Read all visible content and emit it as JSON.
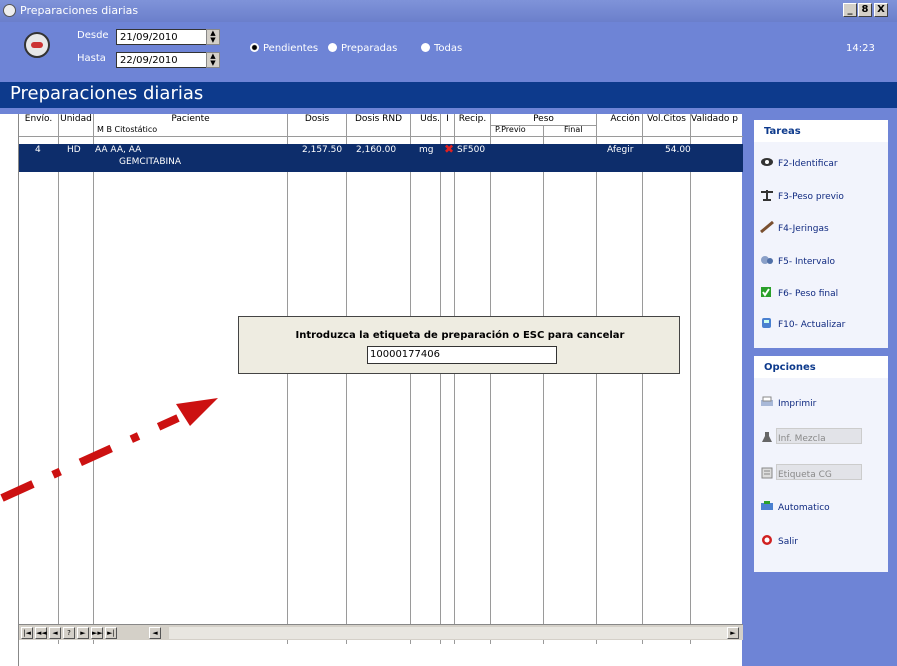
{
  "window": {
    "title": "Preparaciones diarias",
    "buttons": [
      "_",
      "8",
      "X"
    ]
  },
  "header": {
    "desde_label": "Desde",
    "hasta_label": "Hasta",
    "desde_value": "21/09/2010",
    "hasta_value": "22/09/2010",
    "radios": [
      {
        "label": "Pendientes",
        "selected": true
      },
      {
        "label": "Preparadas",
        "selected": false
      },
      {
        "label": "Todas",
        "selected": false
      }
    ],
    "clock": "14:23"
  },
  "section_title": "Preparaciones diarias",
  "table": {
    "headers": [
      "Envío.",
      "Unidad",
      "Paciente",
      "Dosis",
      "Dosis RND",
      "Uds.",
      "I",
      "Recip.",
      "Peso",
      "Acción",
      "Vol.Citos",
      "Validado p"
    ],
    "subheaders": {
      "paciente": "M  B  Citostático",
      "peso_previo": "P.Previo",
      "peso_final": "Final"
    },
    "rows": [
      {
        "envio": "4",
        "unidad": "HD",
        "paciente": "AA AA, AA",
        "citostatico": "GEMCITABINA",
        "dosis": "2,157.50",
        "dosis_rnd": "2,160.00",
        "uds": "mg",
        "recip": "SF500",
        "accion": "Afegir",
        "vol_citos": "54.00"
      }
    ]
  },
  "nav": {
    "buttons": [
      "|◄",
      "◄◄",
      "◄",
      "?",
      "►",
      "►►",
      "►|",
      "◄",
      "►"
    ]
  },
  "dialog": {
    "prompt": "Introduzca la etiqueta de preparación o ESC para cancelar",
    "value": "10000177406"
  },
  "tareas": {
    "title": "Tareas",
    "items": [
      "F2-Identificar",
      "F3-Peso previo",
      "F4-Jeringas",
      "F5- Intervalo",
      "F6- Peso final",
      "F10- Actualizar"
    ]
  },
  "opciones": {
    "title": "Opciones",
    "items": [
      "Imprimir",
      "Inf. Mezcla",
      "Etiqueta CG",
      "Automatico",
      "Salir"
    ]
  },
  "colors": {
    "accent": "#0d3a8c",
    "header_bg": "#6e84d6",
    "selection": "#0d2d6b",
    "arrow": "#cc1111"
  }
}
